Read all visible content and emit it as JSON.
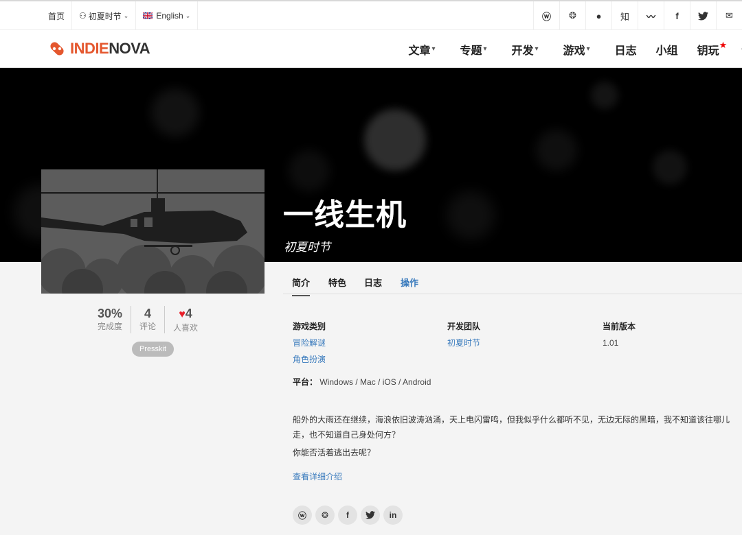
{
  "topbar": {
    "home": "首页",
    "user": "初夏时节",
    "language": "English",
    "social": [
      "weibo-icon",
      "wechat-icon",
      "qq-icon",
      "zhihu-icon",
      "chevron-icon",
      "facebook-icon",
      "twitter-icon",
      "mail-icon"
    ],
    "social_glyphs": [
      "ⓦ",
      "❂",
      "●",
      "知",
      "〰",
      "f",
      "🐦",
      "✉"
    ]
  },
  "logo": {
    "indie": "INDIE",
    "nova": "NOVA"
  },
  "nav": {
    "articles": "文章",
    "topics": "专题",
    "dev": "开发",
    "games": "游戏",
    "logs": "日志",
    "groups": "小组",
    "keys": "钥玩"
  },
  "game": {
    "title": "一线生机",
    "developer": "初夏时节"
  },
  "tabs": [
    "简介",
    "特色",
    "日志",
    "操作"
  ],
  "stats": {
    "completion": "30%",
    "completion_label": "完成度",
    "comments": "4",
    "comments_label": "评论",
    "likes": "4",
    "likes_label": "人喜欢"
  },
  "presskit": "Presskit",
  "info": {
    "genre_label": "游戏类别",
    "genres": [
      "冒险解谜",
      "角色扮演"
    ],
    "team_label": "开发团队",
    "team": "初夏时节",
    "version_label": "当前版本",
    "version": "1.01",
    "platform_label": "平台：",
    "platform": "Windows / Mac / iOS / Android"
  },
  "description": [
    "船外的大雨还在继续，海浪依旧波涛汹涌，天上电闪雷鸣，但我似乎什么都听不见，无边无际的黑暗，我不知道该往哪儿走，也不知道自己身处何方？",
    "你能否活着逃出去呢？"
  ],
  "more_link": "查看详细介绍",
  "share": [
    "weibo",
    "wechat",
    "facebook",
    "twitter",
    "linkedin"
  ],
  "colors": {
    "brand": "#e4572e",
    "link": "#3a7bbd",
    "heart": "#e8202a"
  }
}
